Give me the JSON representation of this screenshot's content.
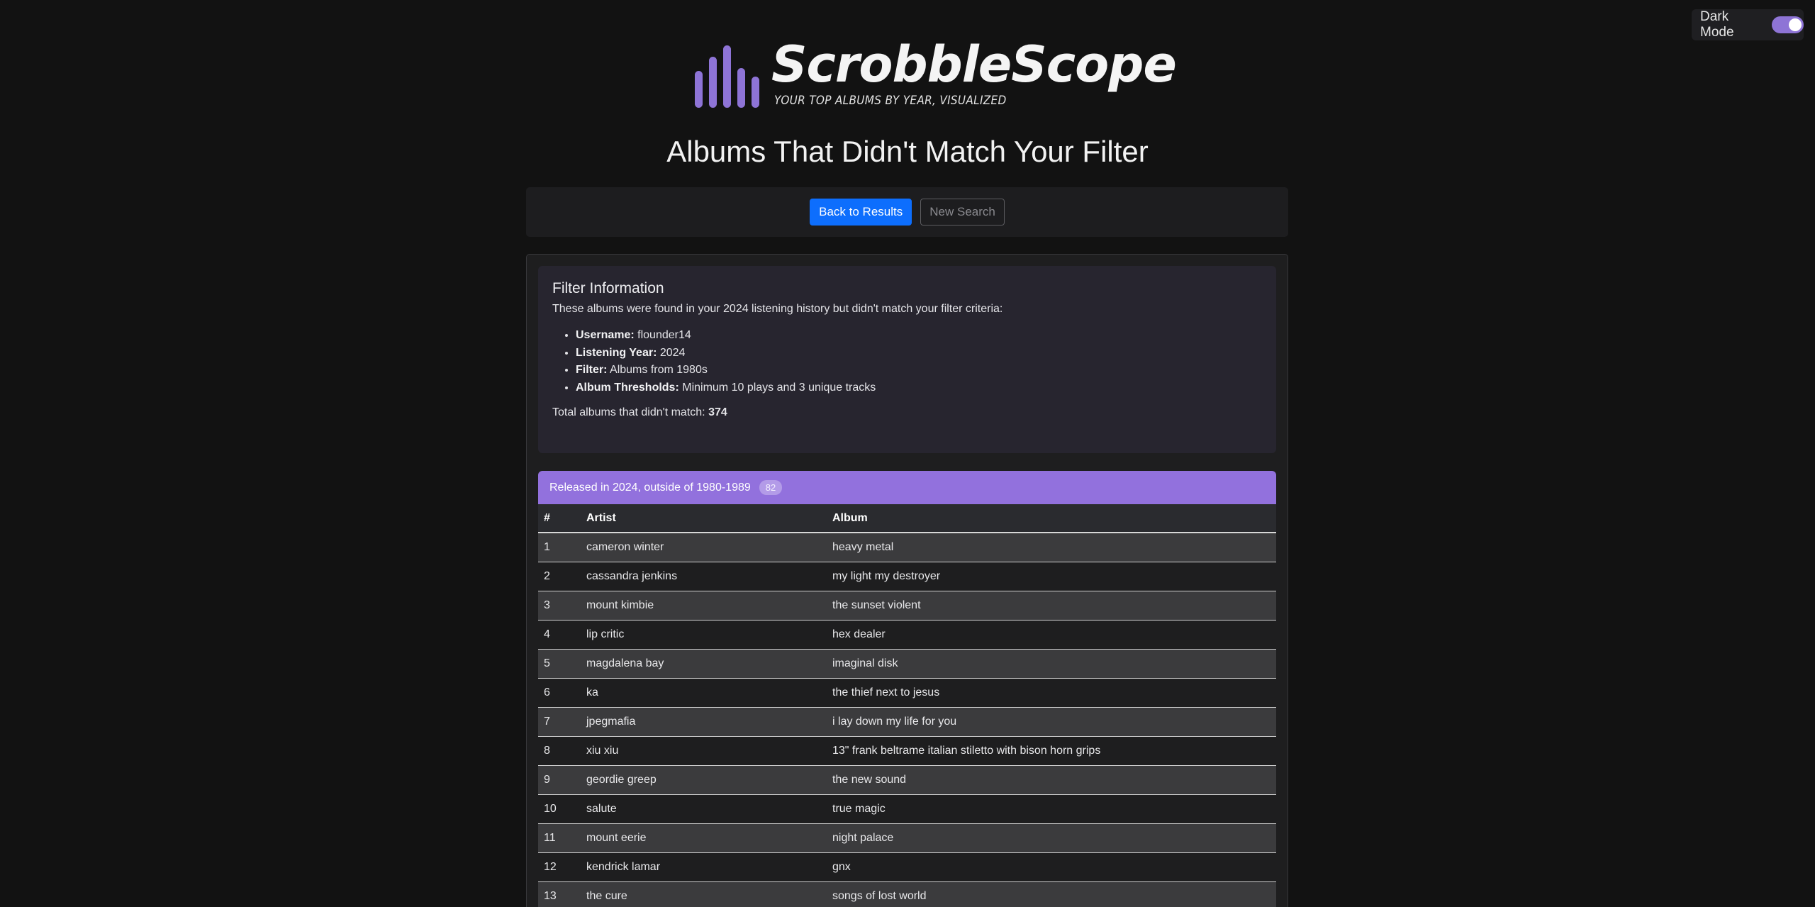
{
  "dark_mode": {
    "label": "Dark Mode",
    "enabled": true
  },
  "logo": {
    "name": "ScrobbleScope",
    "tagline": "YOUR TOP ALBUMS BY YEAR, VISUALIZED"
  },
  "page_title": "Albums That Didn't Match Your Filter",
  "actions": {
    "back_label": "Back to Results",
    "new_search_label": "New Search"
  },
  "filter_info": {
    "heading": "Filter Information",
    "intro": "These albums were found in your 2024 listening history but didn't match your filter criteria:",
    "items": [
      {
        "key": "Username:",
        "value": "flounder14"
      },
      {
        "key": "Listening Year:",
        "value": "2024"
      },
      {
        "key": "Filter:",
        "value": "Albums from 1980s"
      },
      {
        "key": "Album Thresholds:",
        "value": "Minimum 10 plays and 3 unique tracks"
      }
    ],
    "total_label": "Total albums that didn't match:",
    "total_value": "374"
  },
  "group": {
    "title": "Released in 2024, outside of 1980-1989",
    "count": "82",
    "columns": {
      "num": "#",
      "artist": "Artist",
      "album": "Album"
    },
    "rows": [
      {
        "num": "1",
        "artist": "cameron winter",
        "album": "heavy metal"
      },
      {
        "num": "2",
        "artist": "cassandra jenkins",
        "album": "my light my destroyer"
      },
      {
        "num": "3",
        "artist": "mount kimbie",
        "album": "the sunset violent"
      },
      {
        "num": "4",
        "artist": "lip critic",
        "album": "hex dealer"
      },
      {
        "num": "5",
        "artist": "magdalena bay",
        "album": "imaginal disk"
      },
      {
        "num": "6",
        "artist": "ka",
        "album": "the thief next to jesus"
      },
      {
        "num": "7",
        "artist": "jpegmafia",
        "album": "i lay down my life for you"
      },
      {
        "num": "8",
        "artist": "xiu xiu",
        "album": "13\" frank beltrame italian stiletto with bison horn grips"
      },
      {
        "num": "9",
        "artist": "geordie greep",
        "album": "the new sound"
      },
      {
        "num": "10",
        "artist": "salute",
        "album": "true magic"
      },
      {
        "num": "11",
        "artist": "mount eerie",
        "album": "night palace"
      },
      {
        "num": "12",
        "artist": "kendrick lamar",
        "album": "gnx"
      },
      {
        "num": "13",
        "artist": "the cure",
        "album": "songs of lost world"
      }
    ]
  },
  "colors": {
    "accent": "#9271dd",
    "primary": "#0d6efd",
    "background": "#121212"
  }
}
